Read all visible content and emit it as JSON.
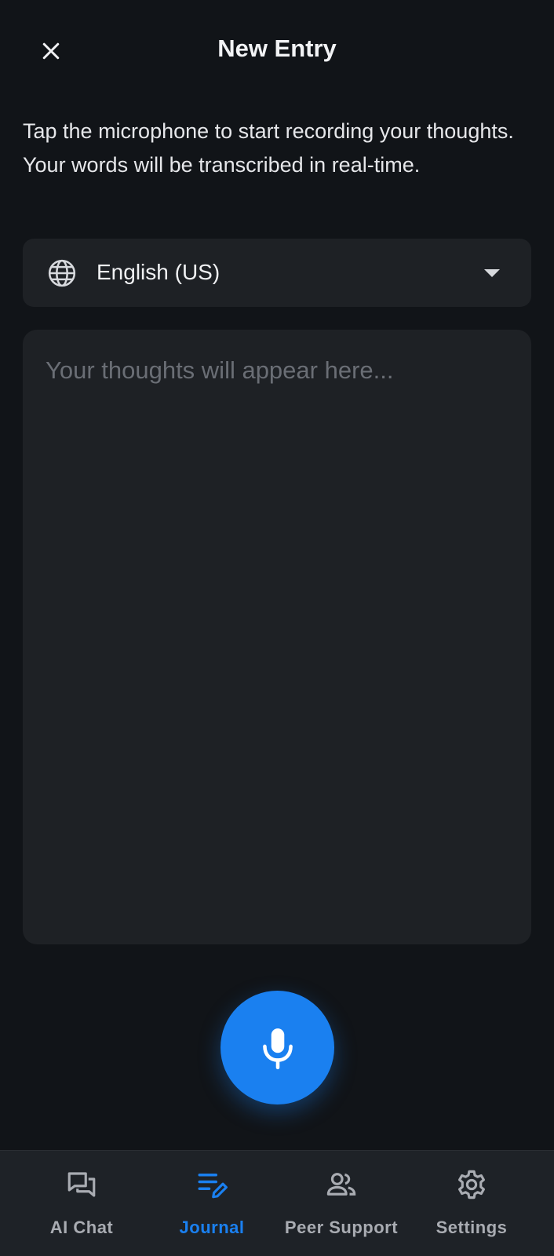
{
  "header": {
    "title": "New Entry",
    "close_icon": "close-icon"
  },
  "instructions": "Tap the microphone to start recording your thoughts. Your words will be transcribed in real-time.",
  "language": {
    "icon": "globe-icon",
    "selected": "English (US)",
    "dropdown_icon": "caret-down-icon"
  },
  "transcript": {
    "value": "",
    "placeholder": "Your thoughts will appear here..."
  },
  "mic_button": {
    "icon": "microphone-icon",
    "color": "#1A80F0"
  },
  "nav": {
    "items": [
      {
        "label": "AI Chat",
        "icon": "chat-bubbles-icon",
        "active": false
      },
      {
        "label": "Journal",
        "icon": "journal-edit-icon",
        "active": true
      },
      {
        "label": "Peer Support",
        "icon": "people-icon",
        "active": false
      },
      {
        "label": "Settings",
        "icon": "gear-icon",
        "active": false
      }
    ],
    "active_color": "#1A80F0",
    "inactive_color": "#A9ACB2"
  }
}
